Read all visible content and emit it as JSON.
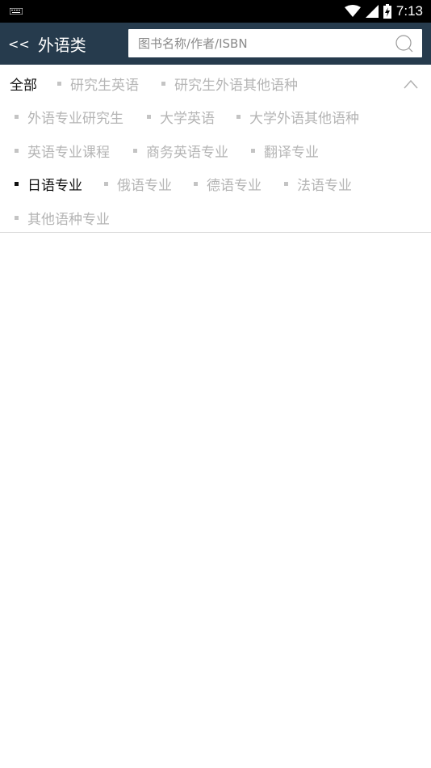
{
  "status_bar": {
    "time": "7:13",
    "icons": [
      "keyboard-icon",
      "wifi-icon",
      "cell-signal-icon",
      "battery-charging-icon"
    ]
  },
  "header": {
    "back_label": "<<",
    "title": "外语类",
    "search_placeholder": "图书名称/作者/ISBN",
    "search_value": ""
  },
  "categories": {
    "all_label": "全部",
    "rows": [
      [
        "研究生英语",
        "研究生外语其他语种"
      ],
      [
        "外语专业研究生",
        "大学英语",
        "大学外语其他语种"
      ],
      [
        "英语专业课程",
        "商务英语专业",
        "翻译专业"
      ],
      [
        "日语专业",
        "俄语专业",
        "德语专业",
        "法语专业"
      ],
      [
        "其他语种专业"
      ]
    ],
    "active": "日语专业",
    "collapse_icon": "chevron-up-icon"
  },
  "colors": {
    "header_bg": "#263b4d",
    "inactive_text": "#b5b5b5",
    "active_text": "#111111"
  }
}
